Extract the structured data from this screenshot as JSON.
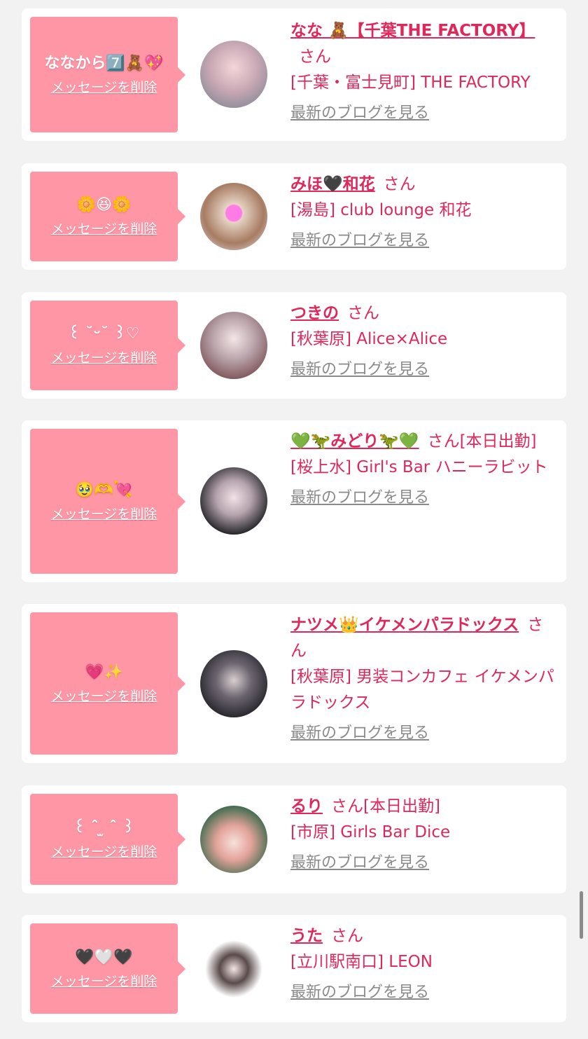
{
  "colors": {
    "accent": "#e0275a",
    "bubble": "#ff96a6",
    "link_gray": "#8a8a8a"
  },
  "items": [
    {
      "message": "ななから7️⃣🧸💖",
      "delete_label": "メッセージを削除",
      "name": "なな 🧸【千葉THE FACTORY】",
      "san": "さん",
      "shop": "[千葉・富士見町] THE FACTORY",
      "blog": "最新のブログを見る"
    },
    {
      "message": "🌼😆🌼",
      "delete_label": "メッセージを削除",
      "name": "みほ🖤和花",
      "san": "さん",
      "shop": "[湯島] club lounge 和花",
      "blog": "最新のブログを見る"
    },
    {
      "message": "꒰ ˘ᵕ˘ ꒱♡",
      "delete_label": "メッセージを削除",
      "name": "つきの",
      "san": "さん",
      "shop": "[秋葉原] Alice×Alice",
      "blog": "最新のブログを見る"
    },
    {
      "message": "🥹🫶💘",
      "delete_label": "メッセージを削除",
      "name": "💚🦖みどり🦖💚",
      "san": "さん[本日出勤]",
      "shop": "[桜上水] Girl's Bar ハニーラビット",
      "blog": "最新のブログを見る"
    },
    {
      "message": "💗✨",
      "delete_label": "メッセージを削除",
      "name": "ナツメ👑イケメンパラドックス",
      "san": "さん",
      "shop": "[秋葉原] 男装コンカフェ イケメンパラドックス",
      "blog": "最新のブログを見る"
    },
    {
      "message": "꒰ ˆ ̫ ˆ ꒱",
      "delete_label": "メッセージを削除",
      "name": "るり",
      "san": "さん[本日出勤]",
      "shop": "[市原] Girls Bar Dice",
      "blog": "最新のブログを見る"
    },
    {
      "message": "🖤🤍🖤",
      "delete_label": "メッセージを削除",
      "name": "うた",
      "san": "さん",
      "shop": "[立川駅南口] LEON",
      "blog": "最新のブログを見る"
    }
  ]
}
